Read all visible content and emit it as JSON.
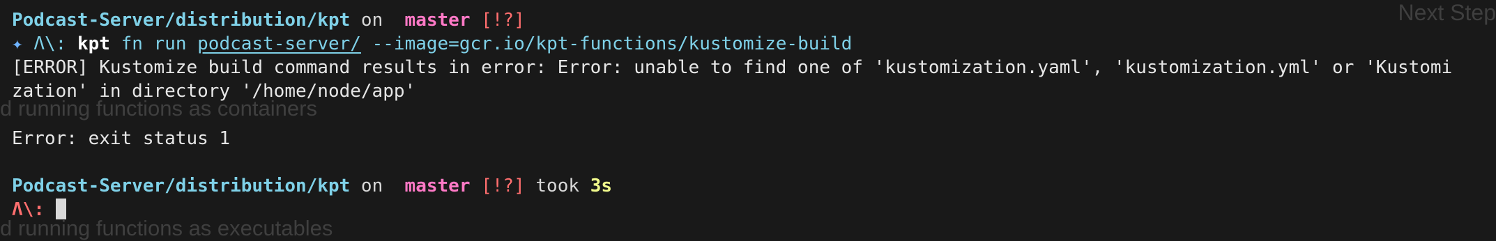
{
  "ghost": {
    "next_step": "Next Step",
    "line_one": "d running functions as containers",
    "line_two": "d running functions as executables"
  },
  "first_prompt": {
    "path": "Podcast-Server/distribution/kpt",
    "on": "on",
    "branch_icon": "",
    "branch": "master",
    "status": "[!?]"
  },
  "command_line": {
    "star": "✦",
    "prompt": "Λ\\:",
    "cmd": "kpt",
    "args_a": "fn run",
    "dir_arg": "podcast-server/",
    "image_arg": "--image=gcr.io/kpt-functions/kustomize-build"
  },
  "output": {
    "error_line_1": "[ERROR] Kustomize build command results in error: Error: unable to find one of 'kustomization.yaml', 'kustomization.yml' or 'Kustomi",
    "error_line_2": "zation' in directory '/home/node/app'",
    "exit_line": "Error: exit status 1"
  },
  "second_prompt": {
    "path": "Podcast-Server/distribution/kpt",
    "on": "on",
    "branch_icon": "",
    "branch": "master",
    "status": "[!?]",
    "took": "took",
    "duration": "3s"
  },
  "input_prompt": {
    "prompt": "Λ\\:",
    "value": ""
  },
  "colors": {
    "background": "#191919",
    "path": "#7fd1e8",
    "branch": "#ff79c6",
    "status": "#ff6e6e",
    "duration": "#f1fa8c"
  }
}
